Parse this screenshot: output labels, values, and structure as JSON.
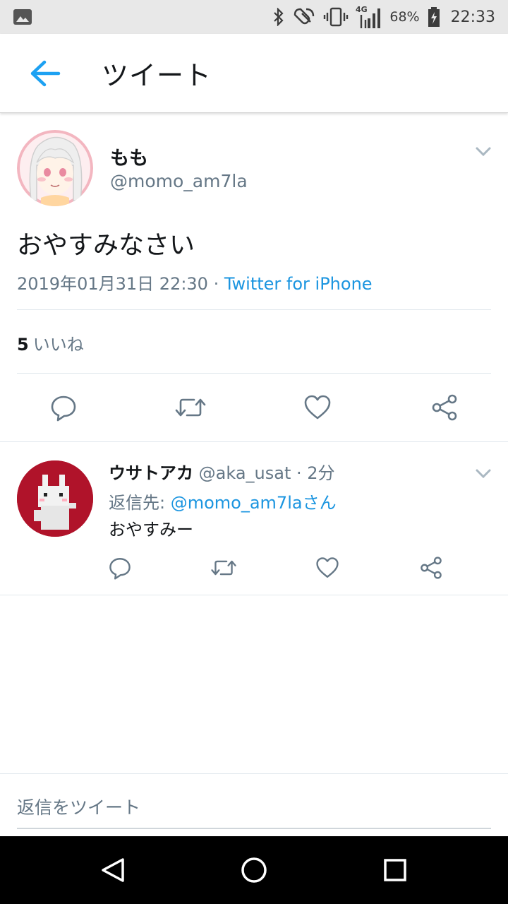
{
  "status_bar": {
    "battery": "68%",
    "network": "4G",
    "time": "22:33"
  },
  "app_bar": {
    "back_icon": "arrow-left-icon",
    "title": "ツイート",
    "accent": "#1da1f2"
  },
  "main_tweet": {
    "author_name": "もも",
    "author_handle": "@momo_am7la",
    "text": "おやすみなさい",
    "datetime": "2019年01月31日 22:30",
    "separator": " · ",
    "source": "Twitter for iPhone",
    "like_count": "5",
    "like_label": "いいね",
    "actions": [
      "reply-icon",
      "retweet-icon",
      "like-icon",
      "share-icon"
    ]
  },
  "reply_tweet": {
    "author_name": "ウサトアカ",
    "author_handle": "@aka_usat",
    "time_sep": " · ",
    "time": "2分",
    "reply_to_label": "返信先: ",
    "reply_to_mention": "@momo_am7laさん",
    "text": "おやすみー",
    "actions": [
      "reply-icon",
      "retweet-icon",
      "like-icon",
      "share-icon"
    ]
  },
  "compose": {
    "placeholder": "返信をツイート"
  },
  "colors": {
    "link": "#1b95e0",
    "secondary_text": "#657786",
    "primary_text": "#14171a",
    "avatar_usa_bg": "#b0132a"
  }
}
